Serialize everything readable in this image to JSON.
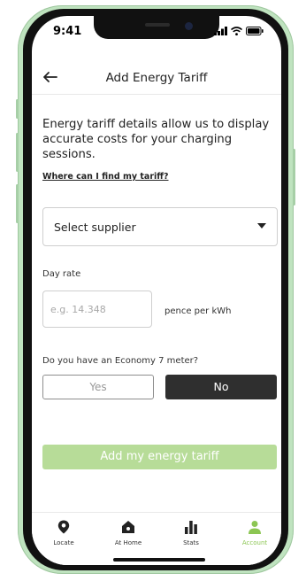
{
  "status_bar": {
    "time": "9:41"
  },
  "header": {
    "title": "Add Energy Tariff"
  },
  "intro_text": "Energy tariff details allow us to display accurate costs for your charging sessions.",
  "help_link": "Where can I find my tariff?",
  "supplier_select": {
    "value": "Select supplier"
  },
  "day_rate": {
    "label": "Day rate",
    "placeholder": "e.g. 14.348",
    "unit": "pence per kWh"
  },
  "economy7": {
    "question": "Do you have an Economy 7 meter?",
    "yes_label": "Yes",
    "no_label": "No"
  },
  "submit_button": {
    "label": "Add my energy tariff"
  },
  "tabbar": {
    "items": [
      {
        "label": "Locate",
        "icon": "location-pin-icon"
      },
      {
        "label": "At Home",
        "icon": "home-icon"
      },
      {
        "label": "Stats",
        "icon": "bar-chart-icon"
      },
      {
        "label": "Account",
        "icon": "person-icon",
        "active": true
      }
    ]
  },
  "colors": {
    "accent_green": "#8cc653",
    "button_disabled_green": "#b7dc98",
    "selected_dark": "#2f2f2f"
  }
}
